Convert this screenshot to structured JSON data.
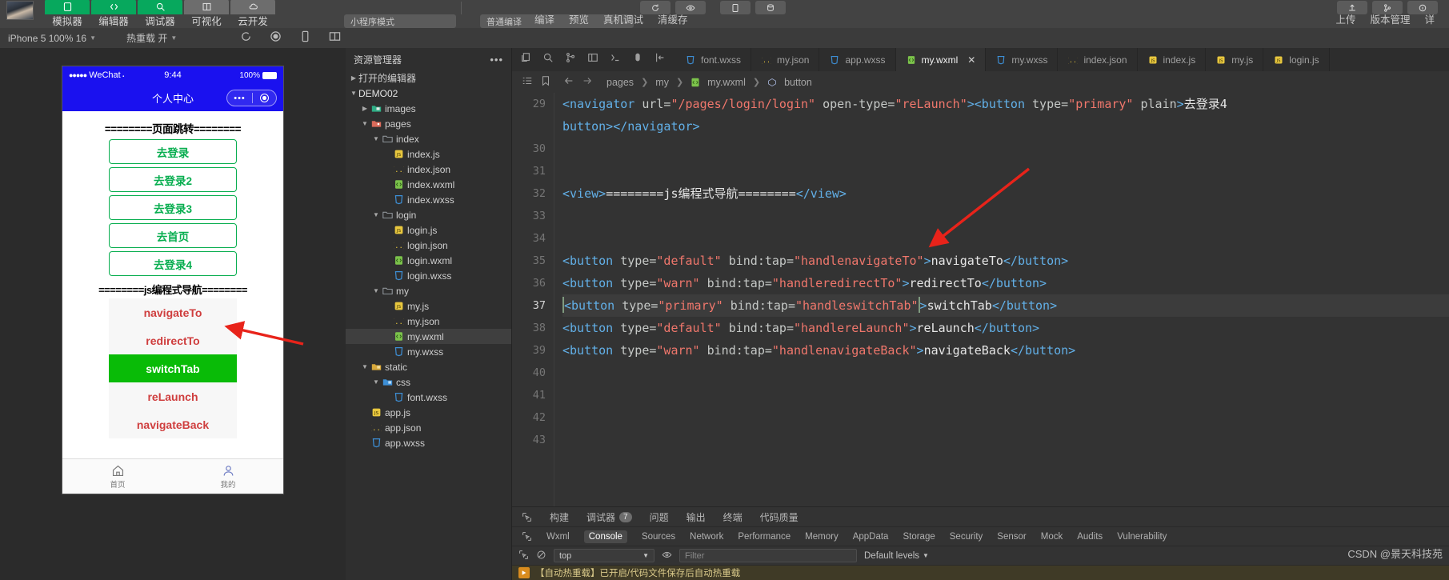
{
  "topbar": {
    "tools": [
      {
        "label": "模拟器",
        "icon": "simulator-icon",
        "color": "green"
      },
      {
        "label": "编辑器",
        "icon": "editor-icon",
        "color": "green"
      },
      {
        "label": "调试器",
        "icon": "debugger-icon",
        "color": "green"
      },
      {
        "label": "可视化",
        "icon": "visual-icon",
        "color": "grey"
      },
      {
        "label": "云开发",
        "icon": "cloud-icon",
        "color": "grey"
      }
    ],
    "mode_pill": "小程序模式",
    "branch_pill": "普通编译",
    "actions": [
      "编译",
      "预览",
      "真机调试",
      "清缓存"
    ],
    "right_actions": [
      "上传",
      "版本管理",
      "详"
    ],
    "icon_names": [
      "refresh-icon",
      "eye-icon",
      "phone-debug-icon",
      "clear-cache-icon",
      "upload-icon",
      "version-icon"
    ]
  },
  "secondbar": {
    "device": "iPhone 5 100% 16",
    "hotreload": "热重载 开",
    "icons": [
      "refresh-icon",
      "record-icon",
      "phone-icon",
      "split-icon"
    ]
  },
  "simulator": {
    "status": {
      "carrier": "WeChat",
      "time": "9:44",
      "battery": "100%"
    },
    "nav_title": "个人中心",
    "cut_text": "",
    "section1": "========页面跳转========",
    "nav_buttons": [
      "去登录",
      "去登录2",
      "去登录3",
      "去首页",
      "去登录4"
    ],
    "section2": "========js编程式导航========",
    "js_buttons": [
      {
        "label": "navigateTo",
        "style": "def"
      },
      {
        "label": "redirectTo",
        "style": "warn"
      },
      {
        "label": "switchTab",
        "style": "prim"
      },
      {
        "label": "reLaunch",
        "style": "def"
      },
      {
        "label": "navigateBack",
        "style": "warn"
      }
    ],
    "tabbar": [
      {
        "label": "首页",
        "icon": "home-icon"
      },
      {
        "label": "我的",
        "icon": "user-icon"
      }
    ]
  },
  "explorer": {
    "title": "资源管理器",
    "more_icon": "more-icon",
    "open_editors": "打开的编辑器",
    "project": "DEMO02",
    "tree": [
      {
        "label": "images",
        "depth": 2,
        "type": "folder-img",
        "twisty": "right",
        "sel": false
      },
      {
        "label": "pages",
        "depth": 2,
        "type": "folder-pages",
        "twisty": "down",
        "sel": false
      },
      {
        "label": "index",
        "depth": 3,
        "type": "folder",
        "twisty": "down",
        "sel": false
      },
      {
        "label": "index.js",
        "depth": 4,
        "type": "js",
        "twisty": "",
        "sel": false
      },
      {
        "label": "index.json",
        "depth": 4,
        "type": "json",
        "twisty": "",
        "sel": false
      },
      {
        "label": "index.wxml",
        "depth": 4,
        "type": "wxml",
        "twisty": "",
        "sel": false
      },
      {
        "label": "index.wxss",
        "depth": 4,
        "type": "wxss",
        "twisty": "",
        "sel": false
      },
      {
        "label": "login",
        "depth": 3,
        "type": "folder",
        "twisty": "down",
        "sel": false
      },
      {
        "label": "login.js",
        "depth": 4,
        "type": "js",
        "twisty": "",
        "sel": false
      },
      {
        "label": "login.json",
        "depth": 4,
        "type": "json",
        "twisty": "",
        "sel": false
      },
      {
        "label": "login.wxml",
        "depth": 4,
        "type": "wxml",
        "twisty": "",
        "sel": false
      },
      {
        "label": "login.wxss",
        "depth": 4,
        "type": "wxss",
        "twisty": "",
        "sel": false
      },
      {
        "label": "my",
        "depth": 3,
        "type": "folder",
        "twisty": "down",
        "sel": false
      },
      {
        "label": "my.js",
        "depth": 4,
        "type": "js",
        "twisty": "",
        "sel": false
      },
      {
        "label": "my.json",
        "depth": 4,
        "type": "json",
        "twisty": "",
        "sel": false
      },
      {
        "label": "my.wxml",
        "depth": 4,
        "type": "wxml",
        "twisty": "",
        "sel": true
      },
      {
        "label": "my.wxss",
        "depth": 4,
        "type": "wxss",
        "twisty": "",
        "sel": false
      },
      {
        "label": "static",
        "depth": 2,
        "type": "folder-static",
        "twisty": "down",
        "sel": false
      },
      {
        "label": "css",
        "depth": 3,
        "type": "folder-css",
        "twisty": "down",
        "sel": false
      },
      {
        "label": "font.wxss",
        "depth": 4,
        "type": "wxss",
        "twisty": "",
        "sel": false
      },
      {
        "label": "app.js",
        "depth": 2,
        "type": "js",
        "twisty": "",
        "sel": false
      },
      {
        "label": "app.json",
        "depth": 2,
        "type": "json",
        "twisty": "",
        "sel": false
      },
      {
        "label": "app.wxss",
        "depth": 2,
        "type": "wxss",
        "twisty": "",
        "sel": false
      }
    ]
  },
  "editor": {
    "gutter_icons": [
      "copy-icon",
      "search-icon",
      "branch-icon",
      "layout-icon",
      "terminal-icon",
      "debug-icon",
      "collapse-icon"
    ],
    "tabs": [
      {
        "label": "font.wxss",
        "type": "wxss",
        "active": false,
        "closable": false
      },
      {
        "label": "my.json",
        "type": "json",
        "active": false,
        "closable": false
      },
      {
        "label": "app.wxss",
        "type": "wxss",
        "active": false,
        "closable": false
      },
      {
        "label": "my.wxml",
        "type": "wxml",
        "active": true,
        "closable": true
      },
      {
        "label": "my.wxss",
        "type": "wxss",
        "active": false,
        "closable": false
      },
      {
        "label": "index.json",
        "type": "json",
        "active": false,
        "closable": false
      },
      {
        "label": "index.js",
        "type": "js",
        "active": false,
        "closable": false
      },
      {
        "label": "my.js",
        "type": "js",
        "active": false,
        "closable": false
      },
      {
        "label": "login.js",
        "type": "js",
        "active": false,
        "closable": false
      }
    ],
    "breadcrumb": [
      "pages",
      "my",
      "my.wxml",
      "button"
    ],
    "breadcrumb_icons": [
      "list-icon",
      "bookmark-icon",
      "back-arrow-icon",
      "forward-arrow-icon"
    ],
    "close_label": "✕",
    "lines": [
      {
        "n": 29,
        "cur": false
      },
      {
        "n": "",
        "cur": false
      },
      {
        "n": 30,
        "cur": false
      },
      {
        "n": 31,
        "cur": false
      },
      {
        "n": 32,
        "cur": false
      },
      {
        "n": 33,
        "cur": false
      },
      {
        "n": 34,
        "cur": false
      },
      {
        "n": 35,
        "cur": false
      },
      {
        "n": 36,
        "cur": false
      },
      {
        "n": 37,
        "cur": true
      },
      {
        "n": 38,
        "cur": false
      },
      {
        "n": 39,
        "cur": false
      },
      {
        "n": 40,
        "cur": false
      },
      {
        "n": 41,
        "cur": false
      },
      {
        "n": 42,
        "cur": false
      },
      {
        "n": 43,
        "cur": false
      }
    ],
    "code": {
      "l29a_tag1": "<navigator",
      "l29a_attr1": " url=",
      "l29a_str1": "\"/pages/login/login\"",
      "l29a_attr2": " open-type=",
      "l29a_str2": "\"reLaunch\"",
      "l29a_gt": ">",
      "l29a_tag2": "<button",
      "l29a_attr3": " type=",
      "l29a_str3": "\"primary\"",
      "l29a_attr4": " plain",
      "l29a_gt2": ">",
      "l29a_text": "去登录4",
      "l29b": "button></navigator>",
      "l32_open": "<view>",
      "l32_text": "========js编程式导航========",
      "l32_close": "</view>",
      "l35_tag": "<button",
      "l35_attr": " type=",
      "l35_type": "\"default\"",
      "l35_bind": "  bind:tap=",
      "l35_handler": "\"handlenavigateTo\"",
      "l35_gt": ">",
      "l35_text": "navigateTo",
      "l35_end": "</button>",
      "l36_tag": "<button",
      "l36_attr": " type=",
      "l36_type": "\"warn\"",
      "l36_bind": " bind:tap=",
      "l36_handler": "\"handleredirectTo\"",
      "l36_gt": ">",
      "l36_text": "redirectTo",
      "l36_end": "</button>",
      "l37_tag": "<button",
      "l37_attr": " type=",
      "l37_type": "\"primary\"",
      "l37_bind": " bind:tap=",
      "l37_handler": "\"handleswitchTab\"",
      "l37_gt": ">",
      "l37_text": "switchTab",
      "l37_end": "</button>",
      "l38_tag": "<button",
      "l38_attr": " type=",
      "l38_type": "\"default\"",
      "l38_bind": " bind:tap=",
      "l38_handler": "\"handlereLaunch\"",
      "l38_gt": ">",
      "l38_text": "reLaunch",
      "l38_end": "</button>",
      "l39_tag": "<button",
      "l39_attr": " type=",
      "l39_type": "\"warn\"",
      "l39_bind": " bind:tap=",
      "l39_handler": "\"handlenavigateBack\"",
      "l39_gt": ">",
      "l39_text": "navigateBack",
      "l39_end": "</button>"
    }
  },
  "devtools": {
    "panels": [
      "构建",
      "调试器",
      "问题",
      "输出",
      "终端",
      "代码质量"
    ],
    "debugger_badge": "7",
    "tabs": [
      "Wxml",
      "Console",
      "Sources",
      "Network",
      "Performance",
      "Memory",
      "AppData",
      "Storage",
      "Security",
      "Sensor",
      "Mock",
      "Audits",
      "Vulnerability"
    ],
    "active_tab": "Console",
    "context": "top",
    "filter_placeholder": "Filter",
    "levels": "Default levels",
    "message": "【自动热重载】已开启/代码文件保存后自动热重载",
    "icons": [
      "inspect-icon",
      "clear-icon",
      "eye-icon",
      "chevron-down-icon"
    ]
  },
  "watermark": "CSDN @景天科技苑",
  "colors": {
    "accent_green": "#07a85d",
    "wechat_blue": "#1a11ef",
    "wx_green": "#09bb07",
    "arrow_red": "#e8231a",
    "string_red": "#f0776c",
    "tag_blue": "#62b0e8"
  }
}
